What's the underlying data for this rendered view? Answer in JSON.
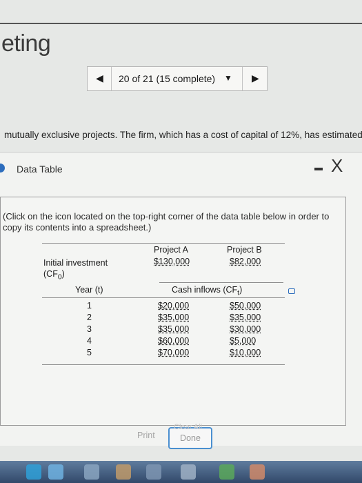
{
  "page": {
    "heading": "eting"
  },
  "pager": {
    "prev_icon": "triangle-left-icon",
    "label": "20 of 21 (15 complete)",
    "dropdown_icon": "triangle-down-icon",
    "next_icon": "triangle-right-icon"
  },
  "question": {
    "text": "mutually exclusive projects.  The firm, which has a cost of capital of 12%, has estimated"
  },
  "modal": {
    "title": "Data Table",
    "minimize_icon": "minimize-icon",
    "close_icon": "close-icon",
    "close_glyph": "X",
    "instruction": "(Click on the icon located on the top-right corner of the data table below in order to copy its contents into a spreadsheet.)"
  },
  "table": {
    "project_a": "Project A",
    "project_b": "Project B",
    "initial_label": "Initial investment",
    "initial_sub": "(CF0)",
    "initial_a": "$130,000",
    "initial_b": "$82,000",
    "year_label": "Year (t)",
    "cash_label": "Cash inflows (CFt)",
    "rows": [
      {
        "year": "1",
        "a": "$20,000",
        "b": "$50,000"
      },
      {
        "year": "2",
        "a": "$35,000",
        "b": "$35,000"
      },
      {
        "year": "3",
        "a": "$35,000",
        "b": "$30,000"
      },
      {
        "year": "4",
        "a": "$60,000",
        "b": "$5,000"
      },
      {
        "year": "5",
        "a": "$70,000",
        "b": "$10,000"
      }
    ]
  },
  "buttons": {
    "print": "Print",
    "done": "Done",
    "clear": "Clear All"
  },
  "colors": {
    "accent": "#2d6dbd",
    "done_border": "#4a8fd0"
  }
}
